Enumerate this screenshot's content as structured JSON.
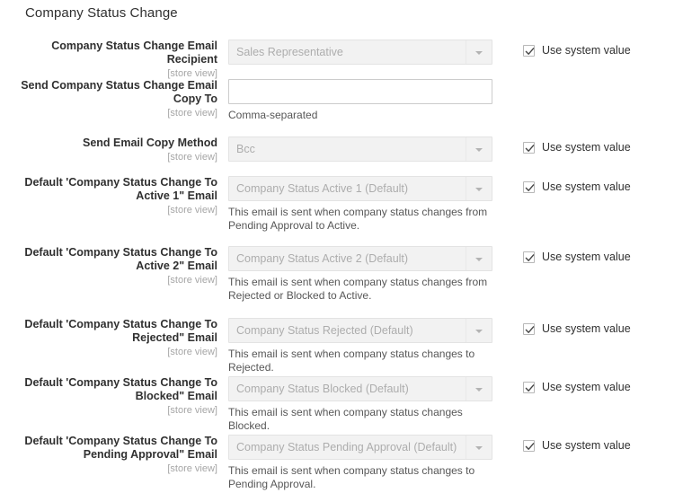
{
  "section": {
    "title": "Company Status Change"
  },
  "common": {
    "store_scope": "[store view]",
    "use_system_value_label": "Use system value",
    "checkbox_icon": "check-icon",
    "dropdown_icon": "chevron-down-icon"
  },
  "colors": {
    "page_background": "#ffffff",
    "text": "#303030",
    "muted_text": "#a6a6a6",
    "disabled_field_background": "#f2f2f2",
    "disabled_field_text": "#adadad",
    "input_border": "#cccccc",
    "note_text": "#575757"
  },
  "fields": [
    {
      "label": "Company Status Change Email Recipient",
      "scope": "[store view]",
      "control": "select",
      "value": "Sales Representative",
      "note": "",
      "system_value": {
        "visible": true,
        "checked": true,
        "label": "Use system value"
      }
    },
    {
      "label": "Send Company Status Change Email Copy To",
      "scope": "[store view]",
      "control": "text",
      "value": "",
      "placeholder": "",
      "note": "Comma-separated",
      "system_value": {
        "visible": false,
        "checked": false,
        "label": "Use system value"
      }
    },
    {
      "label": "Send Email Copy Method",
      "scope": "[store view]",
      "control": "select",
      "value": "Bcc",
      "note": "",
      "system_value": {
        "visible": true,
        "checked": true,
        "label": "Use system value"
      }
    },
    {
      "label": "Default 'Company Status Change To Active 1\" Email",
      "scope": "[store view]",
      "control": "select",
      "value": "Company Status Active 1 (Default)",
      "note": "This email is sent when company status changes from Pending Approval to Active.",
      "system_value": {
        "visible": true,
        "checked": true,
        "label": "Use system value"
      }
    },
    {
      "label": "Default 'Company Status Change To Active 2\" Email",
      "scope": "[store view]",
      "control": "select",
      "value": "Company Status Active 2 (Default)",
      "note": "This email is sent when company status changes from Rejected or Blocked to Active.",
      "system_value": {
        "visible": true,
        "checked": true,
        "label": "Use system value"
      }
    },
    {
      "label": "Default 'Company Status Change To Rejected\" Email",
      "scope": "[store view]",
      "control": "select",
      "value": "Company Status Rejected (Default)",
      "note": "This email is sent when company status changes to Rejected.",
      "system_value": {
        "visible": true,
        "checked": true,
        "label": "Use system value"
      }
    },
    {
      "label": "Default 'Company Status Change To Blocked\" Email",
      "scope": "[store view]",
      "control": "select",
      "value": "Company Status Blocked (Default)",
      "note": "This email is sent when company status changes Blocked.",
      "system_value": {
        "visible": true,
        "checked": true,
        "label": "Use system value"
      }
    },
    {
      "label": "Default 'Company Status Change To Pending Approval\" Email",
      "scope": "[store view]",
      "control": "select",
      "value": "Company Status Pending Approval (Default)",
      "note": "This email is sent when company status changes to Pending Approval.",
      "system_value": {
        "visible": true,
        "checked": true,
        "label": "Use system value"
      }
    }
  ]
}
